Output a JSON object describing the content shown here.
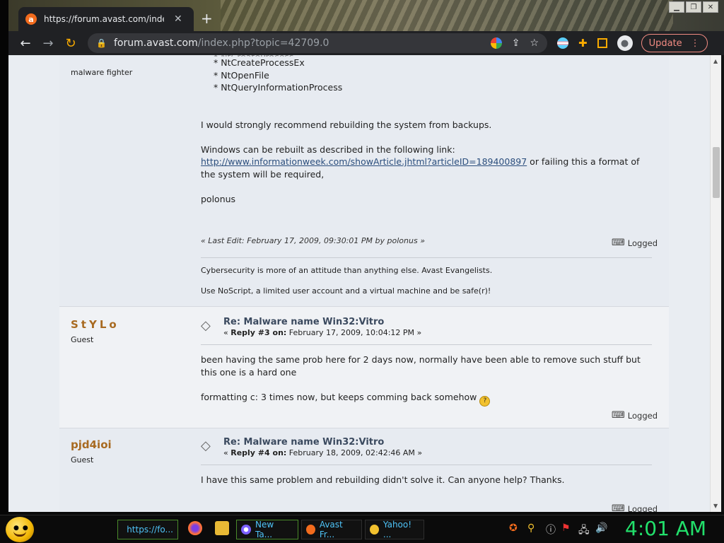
{
  "browser": {
    "tab_title": "https://forum.avast.com/index.php",
    "new_tab_symbol": "+",
    "close_symbol": "✕",
    "url_host": "forum.avast.com",
    "url_path": "/index.php?topic=42709.0",
    "update_label": "Update"
  },
  "post1": {
    "role": "malware fighter",
    "list_items": [
      "* NtCreateProcessEx",
      "* NtOpenFile",
      "* NtQueryInformationProcess"
    ],
    "para1": "I would strongly recommend rebuilding the system from backups.",
    "para2_intro": "Windows can be rebuilt as described in the following link:",
    "link": "http://www.informationweek.com/showArticle.jhtml?articleID=189400897",
    "para2_rest": " or failing this a format of the system will be required,",
    "signoff": "polonus",
    "last_edit": "« Last Edit: February 17, 2009, 09:30:01 PM by polonus »",
    "logged": "Logged",
    "sig1": "Cybersecurity is more of an attitude than anything else. Avast Evangelists.",
    "sig2": "Use NoScript, a limited user account and a virtual machine and be safe(r)!"
  },
  "post2": {
    "author": "StYLo",
    "role": "Guest",
    "subject": "Re: Malware name Win32:Vitro",
    "reply_prefix": "« ",
    "reply_label": "Reply #3 on:",
    "reply_date": " February 17, 2009, 10:04:12 PM »",
    "para1": "been having the same prob here for 2 days now, normally have been able to remove such stuff but this one is a hard one",
    "para2": "formatting c: 3 times now, but keeps comming back somehow ",
    "logged": "Logged"
  },
  "post3": {
    "author": "pjd4ioi",
    "role": "Guest",
    "subject": "Re: Malware name Win32:Vitro",
    "reply_prefix": "« ",
    "reply_label": "Reply #4 on:",
    "reply_date": " February 18, 2009, 02:42:46 AM »",
    "para1": "I have this same problem and rebuilding didn't solve it.  Can anyone help?  Thanks.",
    "logged": "Logged"
  },
  "taskbar": {
    "tasks": [
      "https://fo...",
      "New Ta...",
      "Avast Fr...",
      "Yahoo! ..."
    ],
    "clock": "4:01 AM"
  },
  "colors": {
    "author": "#a86a21",
    "link": "#2b4e7d",
    "clock": "#22e06b",
    "update": "#f28b82"
  }
}
